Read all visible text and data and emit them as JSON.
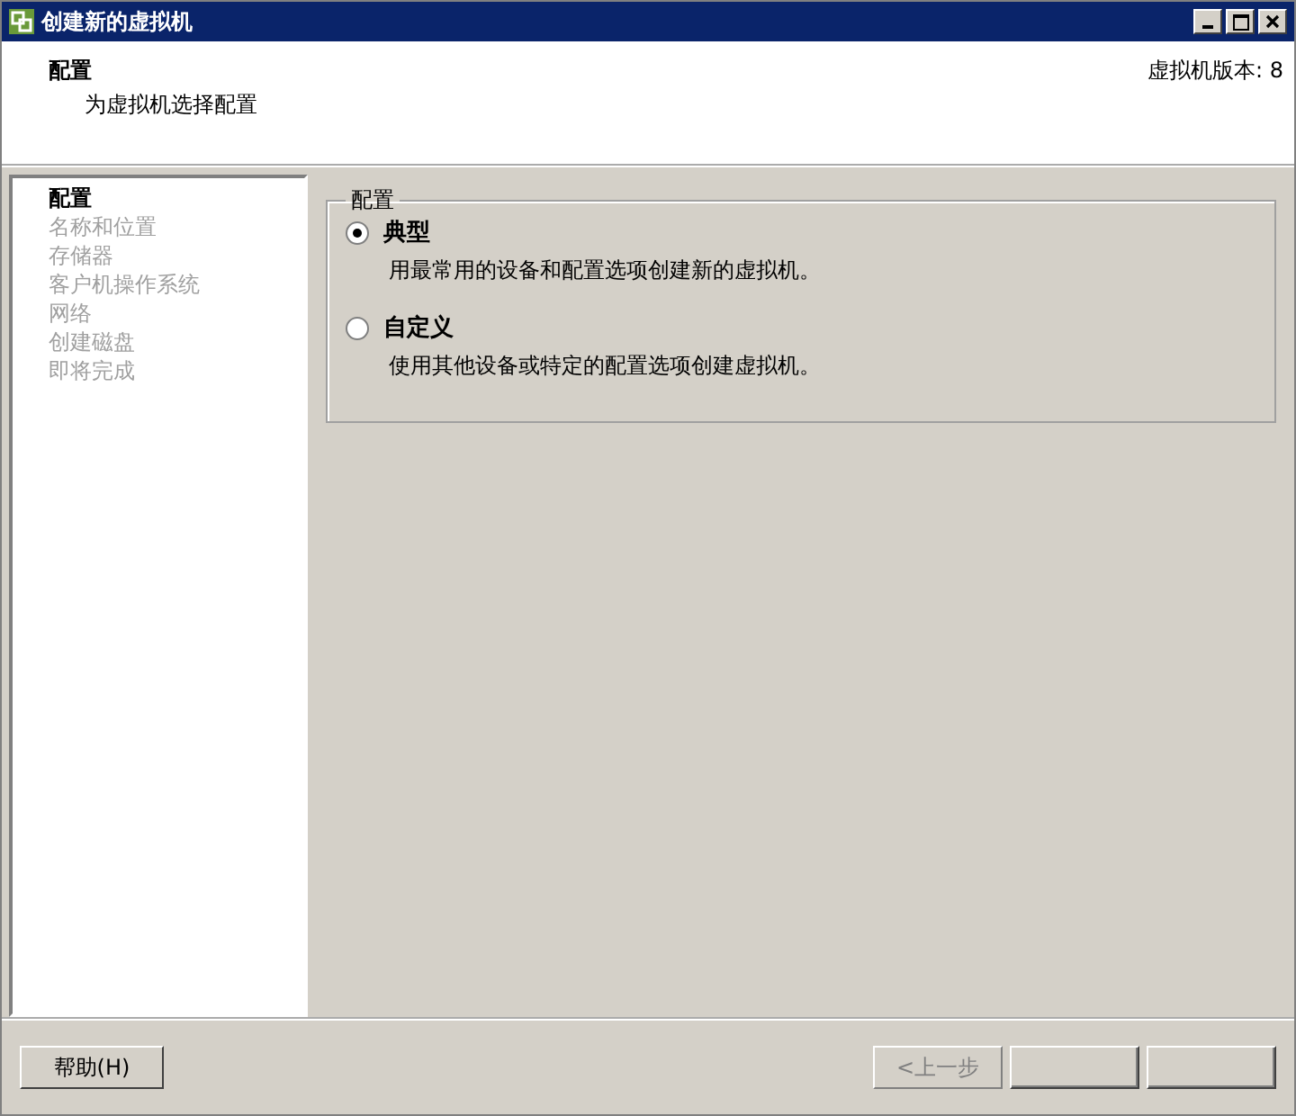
{
  "window": {
    "title": "创建新的虚拟机"
  },
  "header": {
    "title": "配置",
    "subtitle": "为虚拟机选择配置",
    "version": "虚拟机版本: 8"
  },
  "sidebar": {
    "items": [
      {
        "label": "配置",
        "selected": true
      },
      {
        "label": "名称和位置",
        "selected": false
      },
      {
        "label": "存储器",
        "selected": false
      },
      {
        "label": "客户机操作系统",
        "selected": false
      },
      {
        "label": "网络",
        "selected": false
      },
      {
        "label": "创建磁盘",
        "selected": false
      },
      {
        "label": "即将完成",
        "selected": false
      }
    ]
  },
  "group": {
    "title": "配置",
    "options": [
      {
        "label": "典型",
        "description": "用最常用的设备和配置选项创建新的虚拟机。",
        "selected": true
      },
      {
        "label": "自定义",
        "description": "使用其他设备或特定的配置选项创建虚拟机。",
        "selected": false
      }
    ]
  },
  "footer": {
    "help": "帮助(H)",
    "buttons": [
      {
        "label": "<上一步",
        "disabled": true
      },
      {
        "disabled": false
      },
      {
        "disabled": false
      }
    ]
  }
}
